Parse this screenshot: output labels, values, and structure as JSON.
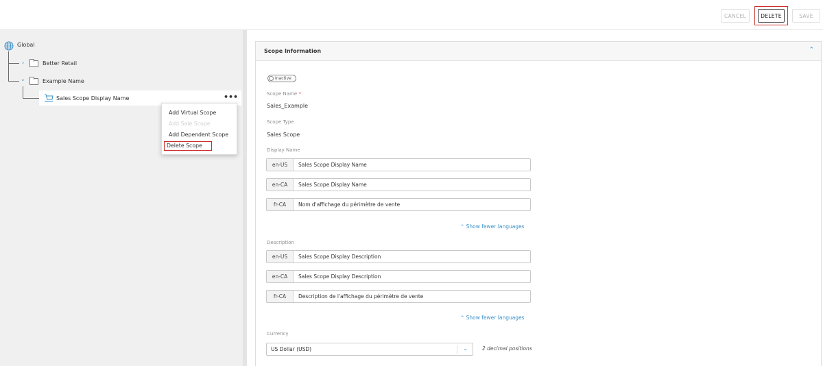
{
  "toolbar": {
    "cancel_label": "CANCEL",
    "delete_label": "DELETE",
    "save_label": "SAVE"
  },
  "tree": {
    "root": {
      "label": "Global",
      "icon": "globe-icon"
    },
    "nodes": [
      {
        "label": "Better Retail",
        "expanded": false,
        "icon": "folder-icon"
      },
      {
        "label": "Example Name",
        "expanded": true,
        "icon": "folder-icon"
      }
    ],
    "selected": {
      "label": "Sales Scope Display Name",
      "icon": "cart-icon",
      "more_label": "•••"
    }
  },
  "context_menu": {
    "items": [
      {
        "label": "Add Virtual Scope",
        "enabled": true
      },
      {
        "label": "Add Sale Scope",
        "enabled": false
      },
      {
        "label": "Add Dependent Scope",
        "enabled": true
      },
      {
        "label": "Delete Scope",
        "enabled": true,
        "highlighted": true
      }
    ]
  },
  "scope_info": {
    "title": "Scope Information",
    "status_toggle": "Inactive",
    "scope_name_label": "Scope Name",
    "required_mark": "*",
    "scope_name_value": "Sales_Example",
    "scope_type_label": "Scope Type",
    "scope_type_value": "Sales Scope",
    "display_name_label": "Display Name",
    "display_names": [
      {
        "code": "en-US",
        "text": "Sales Scope Display Name"
      },
      {
        "code": "en-CA",
        "text": "Sales Scope Display Name"
      },
      {
        "code": "fr-CA",
        "text": "Nom d'affichage du périmètre de vente"
      }
    ],
    "show_fewer_label": "Show fewer languages",
    "description_label": "Description",
    "descriptions": [
      {
        "code": "en-US",
        "text": "Sales Scope Display Description"
      },
      {
        "code": "en-CA",
        "text": "Sales Scope Display Description"
      },
      {
        "code": "fr-CA",
        "text": "Description de l'affichage du périmètre de vente"
      }
    ],
    "currency_label": "Currency",
    "currency_value": "US Dollar (USD)",
    "currency_note": "2 decimal positions"
  },
  "colors": {
    "accent": "#3a8fc8",
    "highlight_border": "#c9302c",
    "left_panel_bg": "#f0f0f0"
  }
}
